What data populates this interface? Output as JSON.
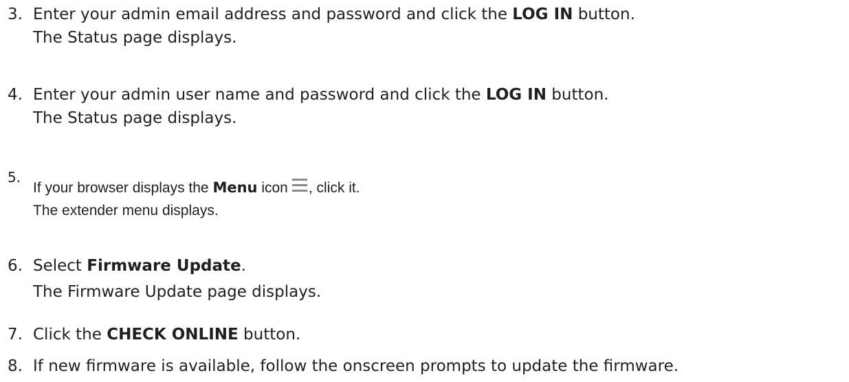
{
  "steps": [
    {
      "number": "3.",
      "line1_a": "Enter your admin email address and password and click the ",
      "line1_bold": "LOG IN",
      "line1_b": " button.",
      "line2": "The Status page displays."
    },
    {
      "number": "4.",
      "line1_a": "Enter your admin user name and password and click the ",
      "line1_bold": "LOG IN",
      "line1_b": " button.",
      "line2": "The Status page displays."
    },
    {
      "number": "5.",
      "line1_a": "If your browser displays the ",
      "line1_bold": "Menu",
      "line1_b": " icon",
      "line1_c": ", click it.",
      "icon": "menu-hamburger-icon",
      "line2": "The extender menu displays."
    },
    {
      "number": "6.",
      "line1_a": "Select ",
      "line1_bold": "Firmware Update",
      "line1_b": ".",
      "line2": "The Firmware Update page displays."
    },
    {
      "number": "7.",
      "line1_a": "Click the ",
      "line1_bold": "CHECK ONLINE",
      "line1_b": " button."
    },
    {
      "number": "8.",
      "line1_a": "If new firmware is available, follow the onscreen prompts to update the firmware."
    }
  ]
}
